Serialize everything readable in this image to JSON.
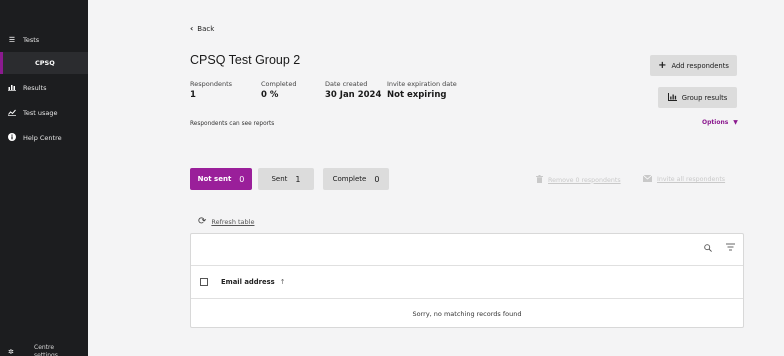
{
  "sidebar": {
    "items": [
      {
        "label": "Tests",
        "icon": "list-icon"
      },
      {
        "label": "CPSQ",
        "icon": ""
      },
      {
        "label": "Results",
        "icon": "bar-chart-icon"
      },
      {
        "label": "Test usage",
        "icon": "line-chart-icon"
      },
      {
        "label": "Help Centre",
        "icon": "info-icon"
      }
    ],
    "centre_label_line1": "Centre",
    "centre_label_line2": "settings"
  },
  "header": {
    "back_label": "Back",
    "title": "CPSQ Test Group 2"
  },
  "stats": [
    {
      "label": "Respondents",
      "value": "1"
    },
    {
      "label": "Completed",
      "value": "0 %"
    },
    {
      "label": "Date created",
      "value": "30 Jan 2024"
    },
    {
      "label": "Invite expiration date",
      "value": "Not expiring"
    }
  ],
  "note": "Respondents can see reports",
  "actions": {
    "add_respondents": "Add respondents",
    "group_results": "Group results",
    "options": "Options"
  },
  "tabs": [
    {
      "label": "Not sent",
      "count": "0"
    },
    {
      "label": "Sent",
      "count": "1"
    },
    {
      "label": "Complete",
      "count": "0"
    }
  ],
  "bulk_actions": {
    "remove": "Remove 0 respondents",
    "invite_all": "Invite all respondents"
  },
  "refresh_label": "Refresh table",
  "table": {
    "column": "Email address",
    "empty_message": "Sorry, no matching records found"
  },
  "colors": {
    "accent": "#9a1f9a",
    "sidebar_bg": "#1c1d1f"
  }
}
